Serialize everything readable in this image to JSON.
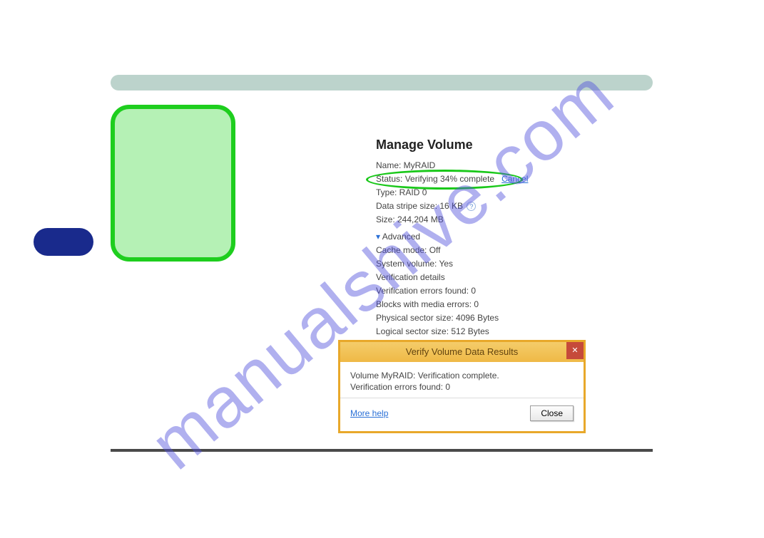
{
  "watermark": "manualshive.com",
  "panel": {
    "heading": "Manage Volume",
    "name_label": "Name: MyRAID",
    "status_label": "Status: Verifying 34% complete",
    "cancel": "Cancel",
    "type_label": "Type: RAID 0",
    "stripe_label": "Data stripe size: 16 KB",
    "size_label": "Size: 244,204 MB",
    "advanced_toggle": "Advanced",
    "cache_mode": "Cache mode: Off",
    "system_volume": "System volume: Yes",
    "verification_details": "Verification details",
    "verif_errors": "Verification errors found: 0",
    "blocks_media": "Blocks with media errors: 0",
    "phys_sector": "Physical sector size: 4096 Bytes",
    "log_sector": "Logical sector size: 512 Bytes"
  },
  "dialog": {
    "title": "Verify Volume Data Results",
    "line1": "Volume MyRAID: Verification complete.",
    "line2": "Verification errors found: 0",
    "more_help": "More help",
    "close_btn": "Close"
  }
}
